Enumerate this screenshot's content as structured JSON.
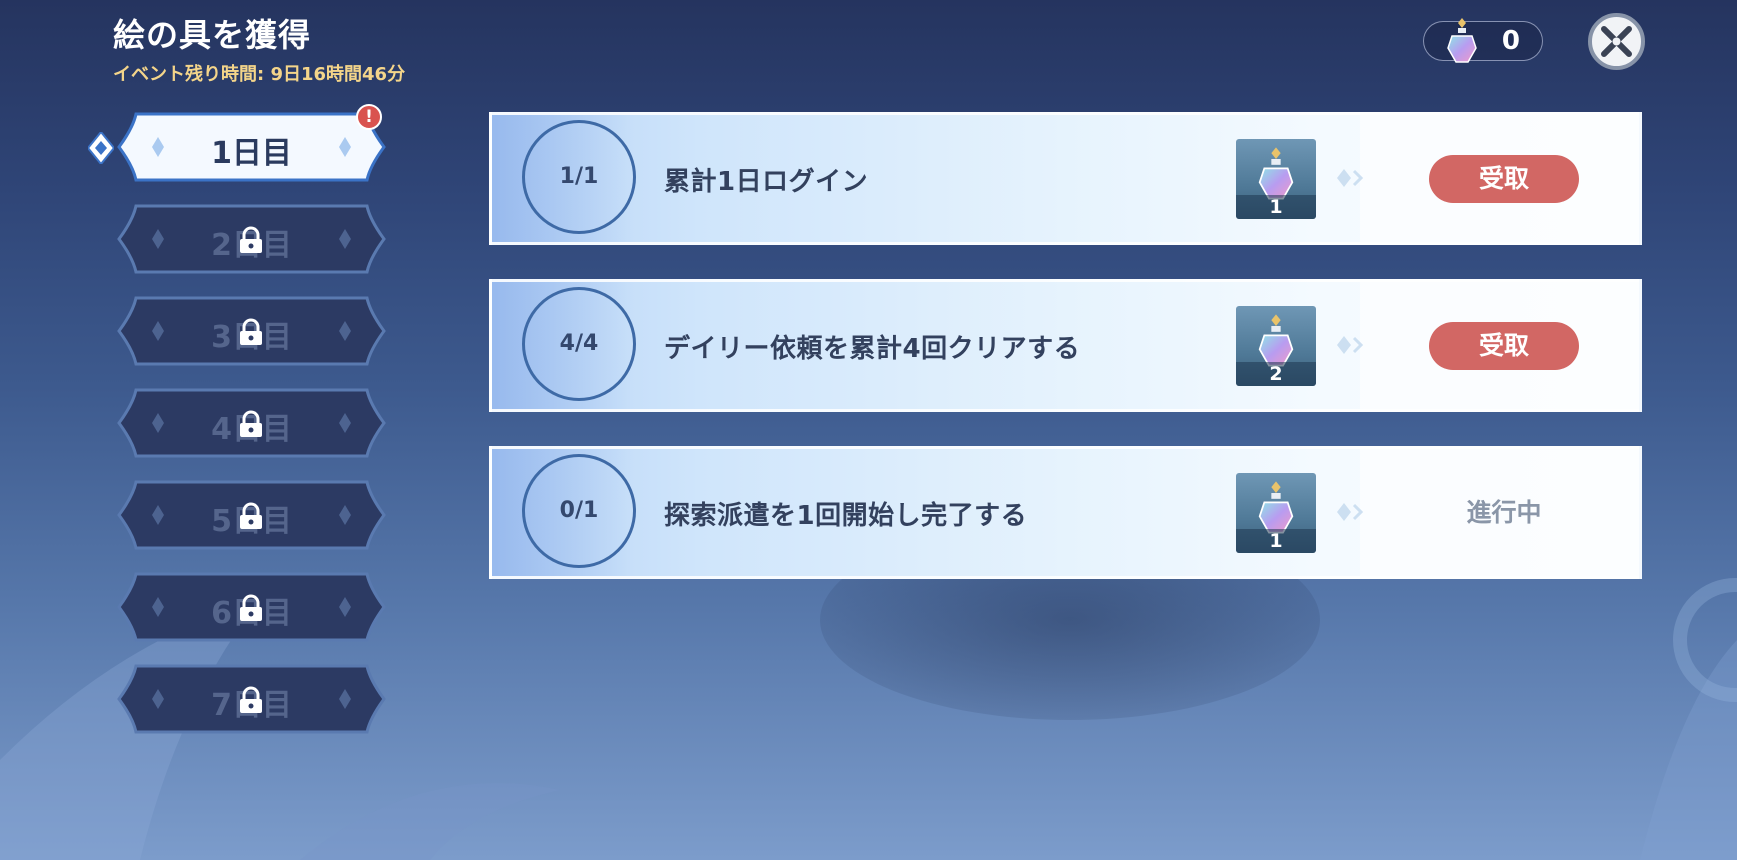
{
  "header": {
    "title": "絵の具を獲得",
    "timer_label": "イベント残り時間: 9日16時間46分"
  },
  "currency": {
    "icon": "paint-bottle-icon",
    "value": "0"
  },
  "close_icon": "close-icon",
  "days": [
    {
      "label": "1日目",
      "state": "active",
      "alert": "!"
    },
    {
      "label": "2日目",
      "state": "locked"
    },
    {
      "label": "3日目",
      "state": "locked"
    },
    {
      "label": "4日目",
      "state": "locked"
    },
    {
      "label": "5日目",
      "state": "locked"
    },
    {
      "label": "6日目",
      "state": "locked"
    },
    {
      "label": "7日目",
      "state": "locked"
    }
  ],
  "quests": [
    {
      "progress": "1/1",
      "text": "累計1日ログイン",
      "reward_icon": "paint-bottle-icon",
      "reward_count": "1",
      "action": "受取",
      "state": "claimable"
    },
    {
      "progress": "4/4",
      "text": "デイリー依頼を累計4回クリアする",
      "reward_icon": "paint-bottle-icon",
      "reward_count": "2",
      "action": "受取",
      "state": "claimable"
    },
    {
      "progress": "0/1",
      "text": "探索派遣を1回開始し完了する",
      "reward_icon": "paint-bottle-icon",
      "reward_count": "1",
      "action": "進行中",
      "state": "in-progress"
    }
  ],
  "colors": {
    "accent_claim": "#d26764",
    "timer_text": "#f4d58a",
    "tab_active_border": "#3b73c7"
  }
}
